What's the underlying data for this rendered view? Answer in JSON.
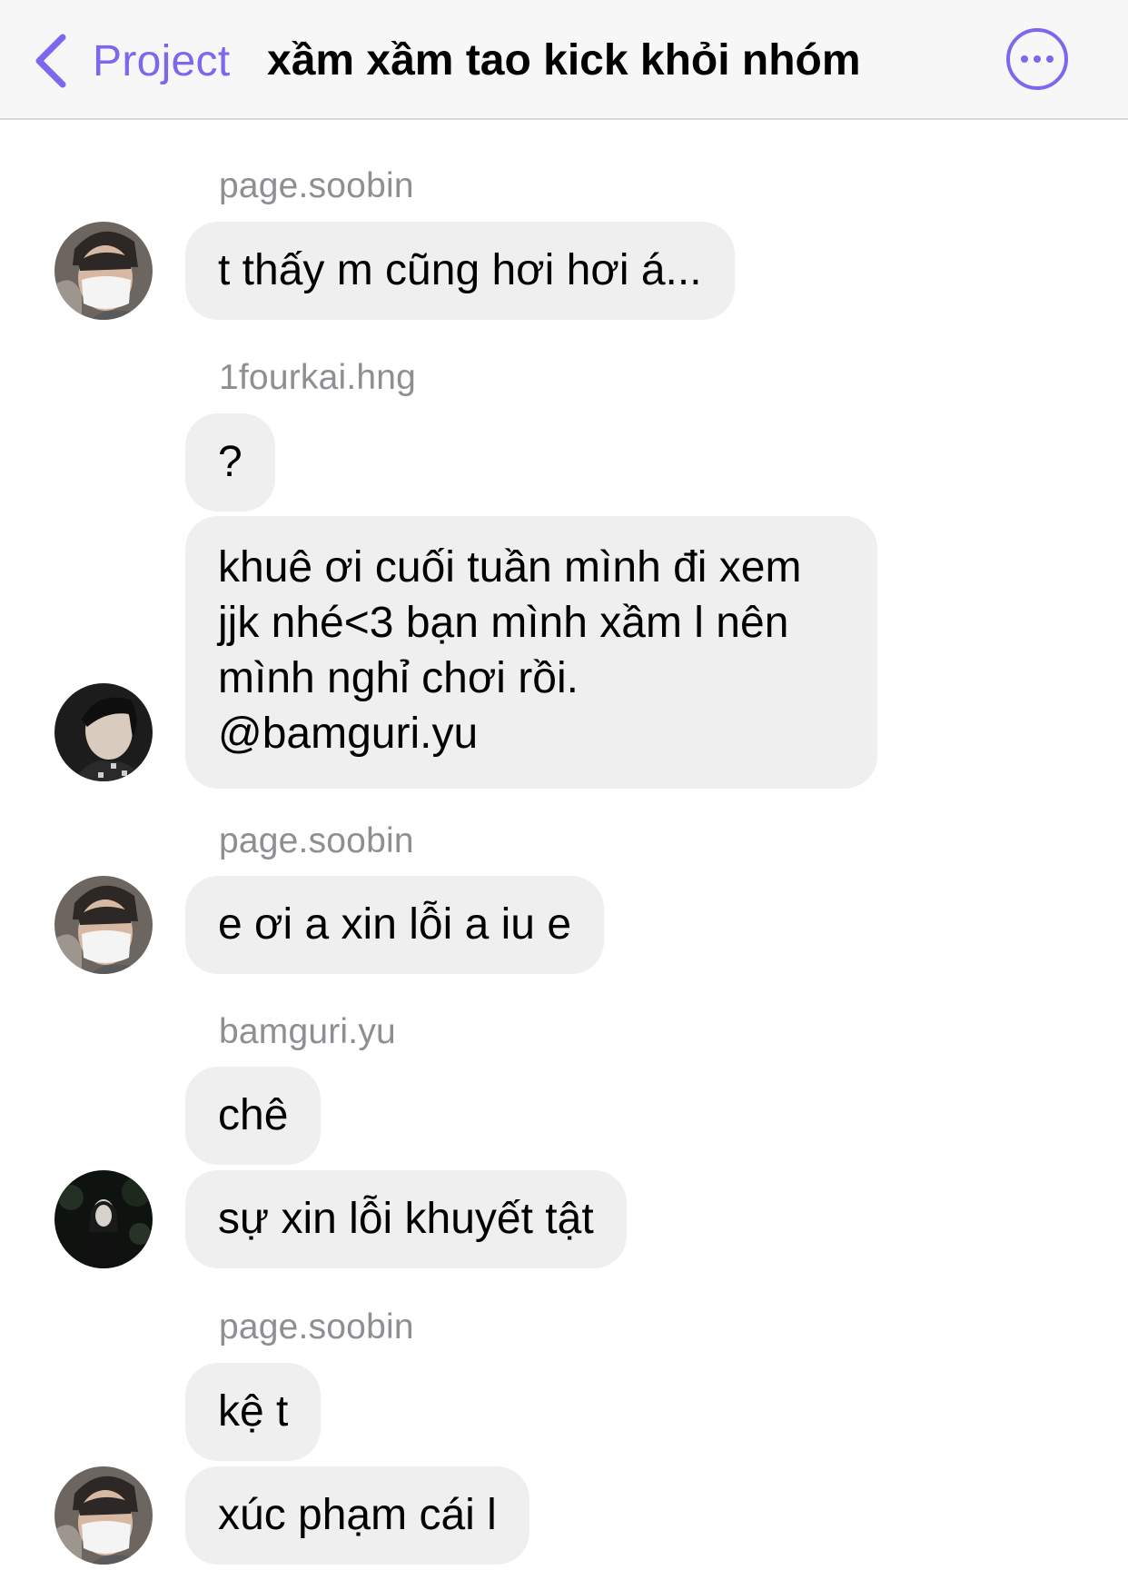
{
  "header": {
    "back_label": "Project",
    "title": "xầm xầm tao kick khỏi nhóm"
  },
  "messages": [
    {
      "sender": "page.soobin",
      "texts": [
        "t thấy m cũng hơi hơi á..."
      ]
    },
    {
      "sender": "1fourkai.hng",
      "texts": [
        "?",
        "khuê ơi cuối tuần mình đi xem jjk nhé<3 bạn mình xầm l nên mình nghỉ chơi rồi. @bamguri.yu"
      ]
    },
    {
      "sender": "page.soobin",
      "texts": [
        "e ơi a xin lỗi a iu e"
      ]
    },
    {
      "sender": "bamguri.yu",
      "texts": [
        "chê",
        "sự xin lỗi khuyết tật"
      ]
    },
    {
      "sender": "page.soobin",
      "texts": [
        "kệ t",
        "xúc phạm cái l"
      ]
    }
  ],
  "colors": {
    "accent": "#7b68ee",
    "bubble": "#efefef",
    "sender_text": "#8e8e93",
    "header_bg": "#f7f7f7"
  },
  "icons": {
    "back": "chevron-left-icon",
    "more": "more-horizontal-icon"
  }
}
